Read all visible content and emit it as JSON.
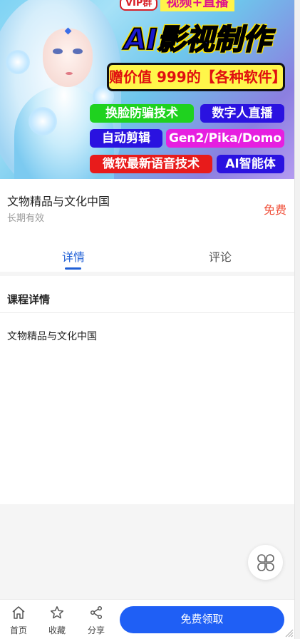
{
  "banner": {
    "vip_badge": "VIP群",
    "vip_subtitle": "视频+直播",
    "headline": "AI影视制作",
    "gift_text": "赠价值 999的【各种软件】",
    "pills": [
      "换脸防骗技术",
      "数字人直播",
      "自动剪辑",
      "Gen2/Pika/Domo",
      "微软最新语音技术",
      "AI智能体"
    ]
  },
  "course": {
    "title": "文物精品与文化中国",
    "validity": "长期有效",
    "price": "免费"
  },
  "tabs": [
    {
      "label": "详情",
      "active": true
    },
    {
      "label": "评论",
      "active": false
    }
  ],
  "details": {
    "heading": "课程详情",
    "body": "文物精品与文化中国"
  },
  "bottom_bar": {
    "home_label": "首页",
    "favorite_label": "收藏",
    "share_label": "分享",
    "cta_label": "免费领取"
  },
  "colors": {
    "accent": "#1f5ff5",
    "price": "#f0503a"
  },
  "icons": {
    "home": "home-icon",
    "favorite": "star-icon",
    "share": "share-icon",
    "menu": "grid-menu-icon"
  }
}
